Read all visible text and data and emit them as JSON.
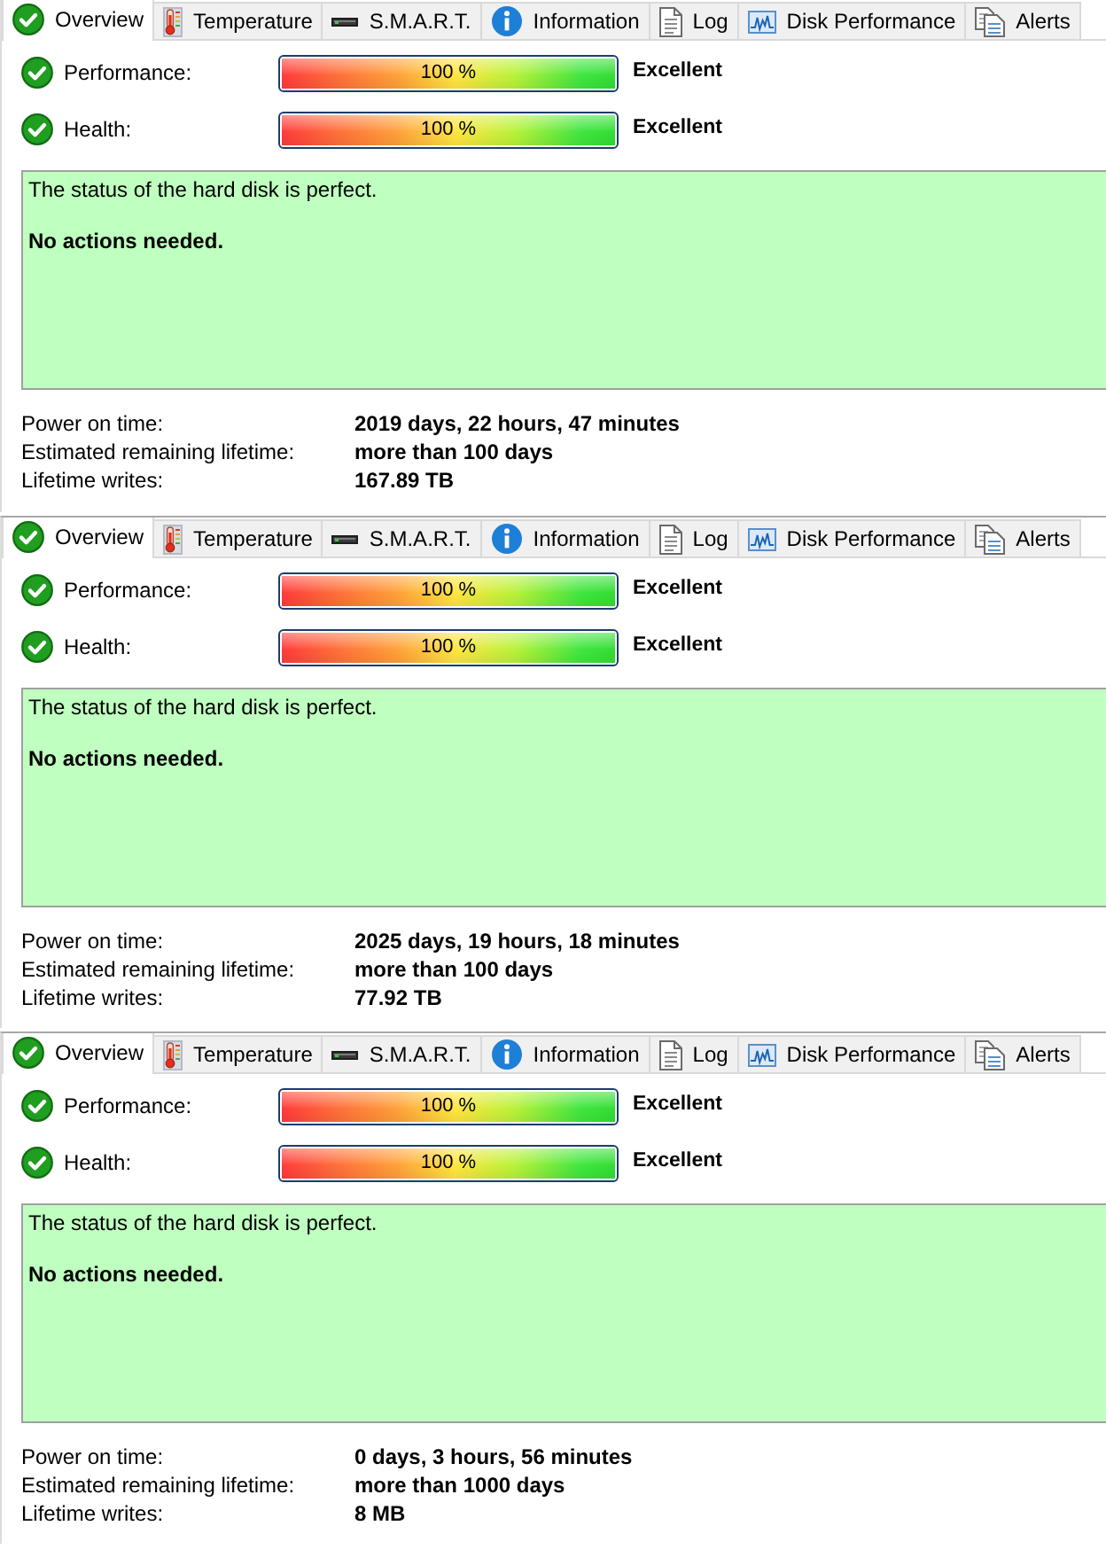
{
  "panels": [
    {
      "tabs": [
        {
          "label": "Overview",
          "selected": true
        },
        {
          "label": "Temperature",
          "selected": false
        },
        {
          "label": "S.M.A.R.T.",
          "selected": false
        },
        {
          "label": "Information",
          "selected": false
        },
        {
          "label": "Log",
          "selected": false
        },
        {
          "label": "Disk Performance",
          "selected": false
        },
        {
          "label": "Alerts",
          "selected": false
        }
      ],
      "meters": [
        {
          "label": "Performance:",
          "level": 1,
          "reading": "100 %",
          "rating": "Excellent"
        },
        {
          "label": "Health:",
          "level": 1,
          "reading": "100 %",
          "rating": "Excellent"
        }
      ],
      "status_box": {
        "message": "The status of the hard disk is perfect.",
        "action": "No actions needed."
      },
      "details": [
        {
          "label": "Power on time:",
          "value": "2019 days, 22 hours, 47 minutes"
        },
        {
          "label": "Estimated remaining lifetime:",
          "value": "more than 100 days"
        },
        {
          "label": "Lifetime writes:",
          "value": "167.89 TB"
        }
      ]
    },
    {
      "tabs": [
        {
          "label": "Overview",
          "selected": true
        },
        {
          "label": "Temperature",
          "selected": false
        },
        {
          "label": "S.M.A.R.T.",
          "selected": false
        },
        {
          "label": "Information",
          "selected": false
        },
        {
          "label": "Log",
          "selected": false
        },
        {
          "label": "Disk Performance",
          "selected": false
        },
        {
          "label": "Alerts",
          "selected": false
        }
      ],
      "meters": [
        {
          "label": "Performance:",
          "level": 1,
          "reading": "100 %",
          "rating": "Excellent"
        },
        {
          "label": "Health:",
          "level": 1,
          "reading": "100 %",
          "rating": "Excellent"
        }
      ],
      "status_box": {
        "message": "The status of the hard disk is perfect.",
        "action": "No actions needed."
      },
      "details": [
        {
          "label": "Power on time:",
          "value": "2025 days, 19 hours, 18 minutes"
        },
        {
          "label": "Estimated remaining lifetime:",
          "value": "more than 100 days"
        },
        {
          "label": "Lifetime writes:",
          "value": "77.92 TB"
        }
      ]
    },
    {
      "tabs": [
        {
          "label": "Overview",
          "selected": true
        },
        {
          "label": "Temperature",
          "selected": false
        },
        {
          "label": "S.M.A.R.T.",
          "selected": false
        },
        {
          "label": "Information",
          "selected": false
        },
        {
          "label": "Log",
          "selected": false
        },
        {
          "label": "Disk Performance",
          "selected": false
        },
        {
          "label": "Alerts",
          "selected": false
        }
      ],
      "meters": [
        {
          "label": "Performance:",
          "level": 1,
          "reading": "100 %",
          "rating": "Excellent"
        },
        {
          "label": "Health:",
          "level": 1,
          "reading": "100 %",
          "rating": "Excellent"
        }
      ],
      "status_box": {
        "message": "The status of the hard disk is perfect.",
        "action": "No actions needed."
      },
      "details": [
        {
          "label": "Power on time:",
          "value": "0 days, 3 hours, 56 minutes"
        },
        {
          "label": "Estimated remaining lifetime:",
          "value": "more than 1000 days"
        },
        {
          "label": "Lifetime writes:",
          "value": "8 MB"
        }
      ]
    }
  ]
}
